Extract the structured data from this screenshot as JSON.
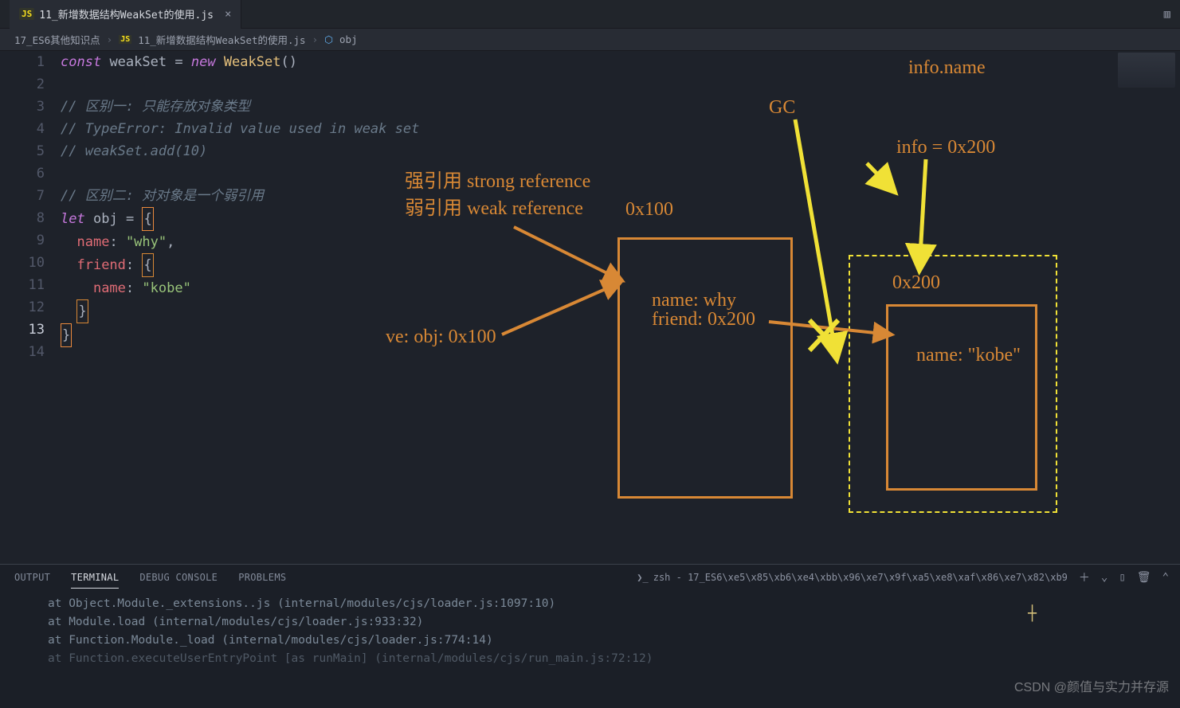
{
  "tab": {
    "filename": "11_新增数据结构WeakSet的使用.js",
    "lang_icon": "JS"
  },
  "breadcrumb": {
    "folder": "17_ES6其他知识点",
    "file_icon": "JS",
    "filename": "11_新增数据结构WeakSet的使用.js",
    "symbol_icon": "⬡",
    "symbol": "obj"
  },
  "code": {
    "lines": [
      {
        "n": 1,
        "seg": [
          {
            "c": "kw",
            "t": "const"
          },
          {
            "t": " "
          },
          {
            "c": "var",
            "t": "weakSet"
          },
          {
            "t": " "
          },
          {
            "c": "op",
            "t": "="
          },
          {
            "t": " "
          },
          {
            "c": "new",
            "t": "new"
          },
          {
            "t": " "
          },
          {
            "c": "cls",
            "t": "WeakSet"
          },
          {
            "c": "op",
            "t": "()"
          }
        ]
      },
      {
        "n": 2,
        "seg": []
      },
      {
        "n": 3,
        "seg": [
          {
            "c": "com",
            "t": "// 区别一: 只能存放对象类型"
          }
        ]
      },
      {
        "n": 4,
        "seg": [
          {
            "c": "com",
            "t": "// TypeError: Invalid value used in weak set"
          }
        ]
      },
      {
        "n": 5,
        "seg": [
          {
            "c": "com",
            "t": "// weakSet.add(10)"
          }
        ]
      },
      {
        "n": 6,
        "seg": []
      },
      {
        "n": 7,
        "seg": [
          {
            "c": "com",
            "t": "// 区别二: 对对象是一个弱引用"
          }
        ]
      },
      {
        "n": 8,
        "seg": [
          {
            "c": "kw",
            "t": "let"
          },
          {
            "t": " "
          },
          {
            "c": "var",
            "t": "obj"
          },
          {
            "t": " "
          },
          {
            "c": "op",
            "t": "="
          },
          {
            "t": " "
          },
          {
            "c": "op brace-box brace-strong",
            "t": "{"
          }
        ]
      },
      {
        "n": 9,
        "seg": [
          {
            "t": "  "
          },
          {
            "c": "id",
            "t": "name"
          },
          {
            "c": "op",
            "t": ":"
          },
          {
            "t": " "
          },
          {
            "c": "str",
            "t": "\"why\""
          },
          {
            "c": "op",
            "t": ","
          }
        ]
      },
      {
        "n": 10,
        "seg": [
          {
            "t": "  "
          },
          {
            "c": "id",
            "t": "friend"
          },
          {
            "c": "op",
            "t": ":"
          },
          {
            "t": " "
          },
          {
            "c": "op brace-box",
            "t": "{"
          }
        ]
      },
      {
        "n": 11,
        "seg": [
          {
            "t": "    "
          },
          {
            "c": "id",
            "t": "name"
          },
          {
            "c": "op",
            "t": ":"
          },
          {
            "t": " "
          },
          {
            "c": "str",
            "t": "\"kobe\""
          }
        ]
      },
      {
        "n": 12,
        "seg": [
          {
            "t": "  "
          },
          {
            "c": "op brace-box",
            "t": "}"
          }
        ]
      },
      {
        "n": 13,
        "seg": [
          {
            "c": "op brace-box brace-strong",
            "t": "}"
          }
        ],
        "cur": true
      },
      {
        "n": 14,
        "seg": []
      }
    ]
  },
  "annotations": {
    "strong_ref": "强引用 strong reference",
    "weak_ref": "弱引用 weak reference",
    "ve_obj": "ve: obj: 0x100",
    "addr1": "0x100",
    "box1_l1": "name: why",
    "box1_l2": "friend: 0x200",
    "gc": "GC",
    "info_name": "info.name",
    "info_eq": "info = 0x200",
    "addr2": "0x200",
    "box2_content": "name: \"kobe\""
  },
  "panel": {
    "tabs": [
      "OUTPUT",
      "TERMINAL",
      "DEBUG CONSOLE",
      "PROBLEMS"
    ],
    "active_tab_index": 1,
    "shell_label": "zsh - 17_ES6\\xe5\\x85\\xb6\\xe4\\xbb\\x96\\xe7\\x9f\\xa5\\xe8\\xaf\\x86\\xe7\\x82\\xb9",
    "lines": [
      "at Object.Module._extensions..js (internal/modules/cjs/loader.js:1097:10)",
      "at Module.load (internal/modules/cjs/loader.js:933:32)",
      "at Function.Module._load (internal/modules/cjs/loader.js:774:14)",
      "at Function.executeUserEntryPoint [as runMain] (internal/modules/cjs/run_main.js:72:12)"
    ]
  },
  "watermark": "CSDN @颜值与实力并存源",
  "chart_data": {
    "type": "diagram",
    "title": "JS object memory reference diagram (strong vs weak reference)",
    "nodes": [
      {
        "id": "var_obj",
        "label": "ve: obj: 0x100",
        "kind": "stack-variable"
      },
      {
        "id": "obj_0x100",
        "address": "0x100",
        "fields": {
          "name": "why",
          "friend": "0x200"
        },
        "kind": "heap-object"
      },
      {
        "id": "obj_0x200",
        "address": "0x200",
        "fields": {
          "name": "\"kobe\""
        },
        "kind": "heap-object",
        "gc_candidate": true
      },
      {
        "id": "var_info",
        "label": "info = 0x200",
        "kind": "stack-variable"
      },
      {
        "id": "expr_info_name",
        "label": "info.name",
        "kind": "expression"
      }
    ],
    "edges": [
      {
        "from": "var_obj",
        "to": "obj_0x100",
        "style": "strong",
        "color": "orange"
      },
      {
        "from": "strong/weak-ref-label",
        "to": "obj_0x100",
        "style": "strong",
        "color": "orange"
      },
      {
        "from": "obj_0x100.friend",
        "to": "obj_0x200",
        "style": "strong",
        "color": "orange"
      },
      {
        "from": "var_info",
        "to": "obj_0x200",
        "style": "strong",
        "color": "yellow"
      },
      {
        "from": "expr_info_name",
        "to": "obj_0x200",
        "style": "strong",
        "color": "yellow"
      },
      {
        "from": "GC",
        "to": "obj_0x200",
        "style": "pointer",
        "color": "yellow"
      }
    ],
    "legend": {
      "strong": "强引用 strong reference",
      "weak": "弱引用 weak reference"
    },
    "gc_label": "GC"
  }
}
